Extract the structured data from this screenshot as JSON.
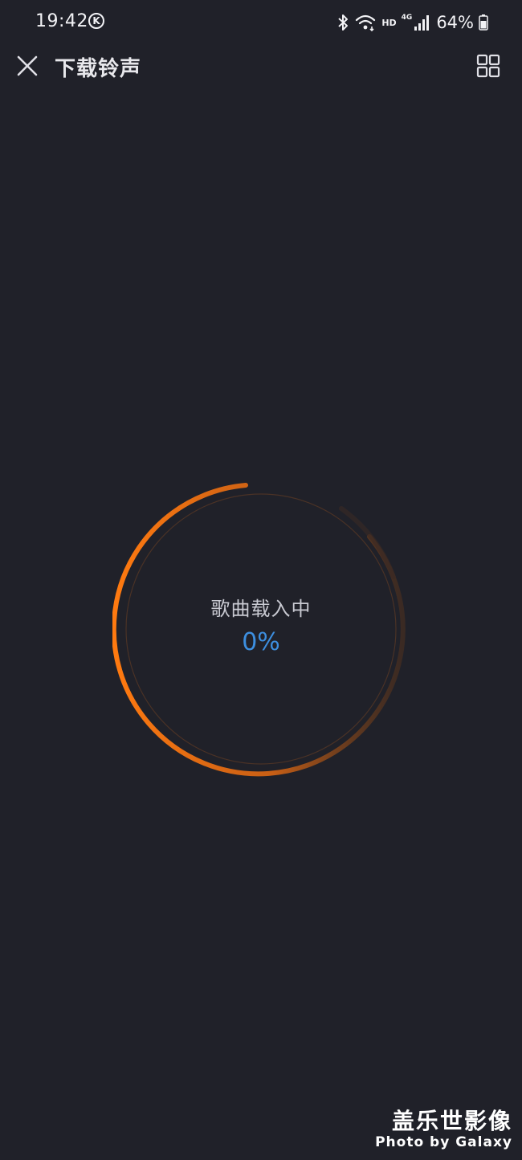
{
  "status_bar": {
    "time": "19:42",
    "k_icon": "K",
    "hd": "HD",
    "network": "4G",
    "battery": "64%"
  },
  "app_bar": {
    "title": "下载铃声"
  },
  "loader": {
    "status_text": "歌曲载入中",
    "percent": "0%",
    "accent_color": "#ff7a10",
    "percent_color": "#3d8fe0"
  },
  "watermark": {
    "title": "盖乐世影像",
    "subtitle": "Photo by Galaxy"
  },
  "theme": {
    "background": "#202129"
  }
}
